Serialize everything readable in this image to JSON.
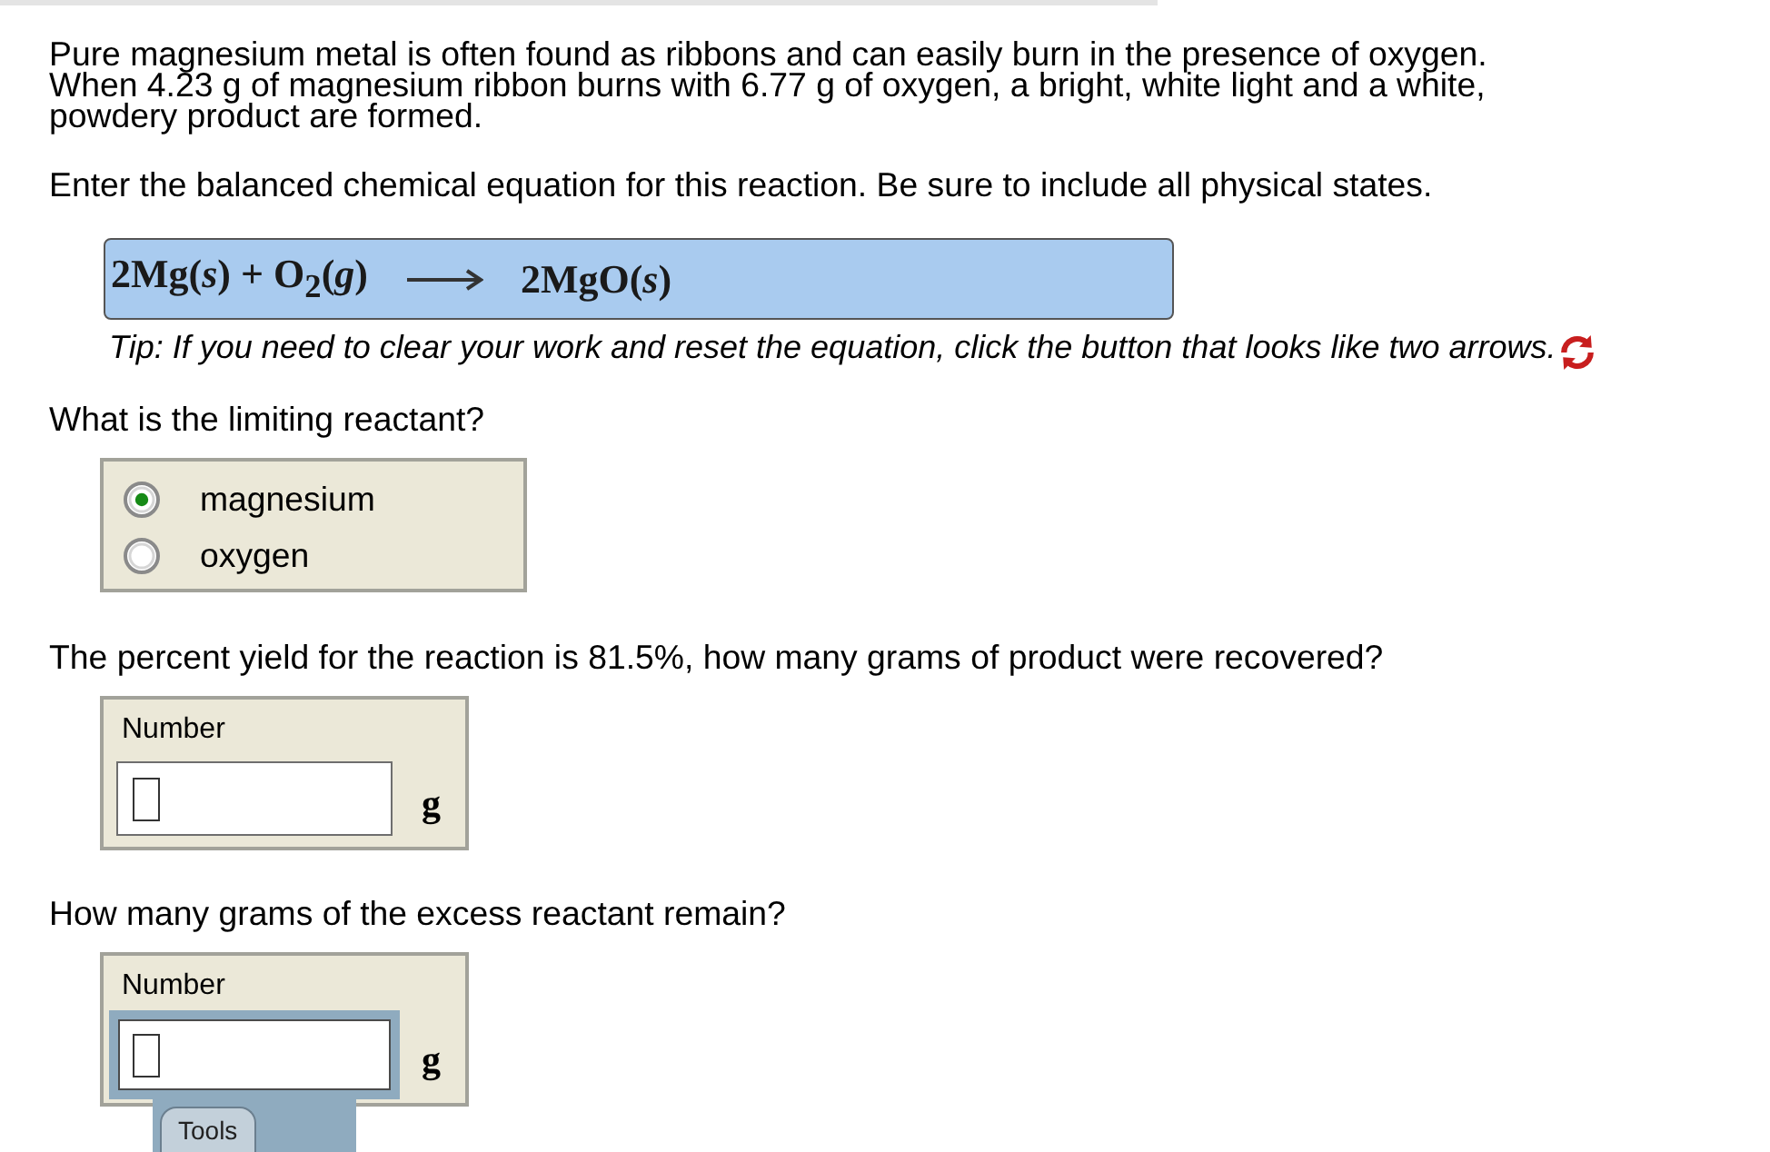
{
  "intro": "Pure magnesium metal is often found as ribbons and can easily burn in the presence of oxygen. When 4.23 g of magnesium ribbon burns with 6.77 g of oxygen, a bright, white light and a white, powdery product are formed.",
  "parts": [
    {
      "kind": "equation",
      "prompt": "Enter the balanced chemical equation for this reaction. Be sure to include all physical states.",
      "equation": {
        "reactants": "2Mg(*s*) + O$_{2}$(*g*)",
        "products": "2MgO(*s*)"
      },
      "tip": "Tip: If you need to clear your work and reset the equation, click the button that looks like two arrows."
    },
    {
      "kind": "choice",
      "prompt": "What is the limiting reactant?",
      "options": [
        {
          "label": "magnesium",
          "selected": true
        },
        {
          "label": "oxygen",
          "selected": false
        }
      ]
    },
    {
      "kind": "number",
      "prompt": "The percent yield for the reaction is 81.5%, how many grams of product were recovered?",
      "field_label": "Number",
      "unit": "g",
      "focused": false
    },
    {
      "kind": "number",
      "prompt": "How many grams of the excess reactant remain?",
      "field_label": "Number",
      "unit": "g",
      "focused": true,
      "tools_tab": "Tools"
    }
  ]
}
